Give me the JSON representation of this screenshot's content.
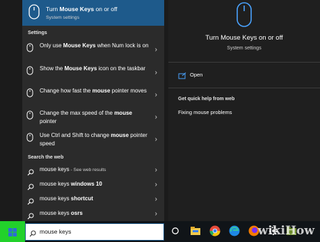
{
  "best_match": {
    "title_prefix": "Turn ",
    "title_bold": "Mouse Keys",
    "title_suffix": " on or off",
    "subtitle": "System settings",
    "icon": "mouse-icon"
  },
  "settings_section": {
    "heading": "Settings",
    "items": [
      {
        "pre": "Only use ",
        "bold": "Mouse Keys",
        "post": " when Num lock is on"
      },
      {
        "pre": "Show the ",
        "bold": "Mouse Keys",
        "post": " icon on the taskbar"
      },
      {
        "pre": "Change how fast the ",
        "bold": "mouse",
        "post": " pointer moves"
      },
      {
        "pre": "Change the max speed of the ",
        "bold": "mouse",
        "post": " pointer"
      },
      {
        "pre": "Use Ctrl and Shift to change ",
        "bold": "mouse",
        "post": " pointer speed"
      }
    ]
  },
  "web_section": {
    "heading": "Search the web",
    "items": [
      {
        "pre": "mouse keys",
        "bold": "",
        "note": " - See web results"
      },
      {
        "pre": "mouse keys ",
        "bold": "windows 10",
        "note": ""
      },
      {
        "pre": "mouse keys ",
        "bold": "shortcut",
        "note": ""
      },
      {
        "pre": "mouse keys ",
        "bold": "osrs",
        "note": ""
      }
    ]
  },
  "preview": {
    "title": "Turn Mouse Keys on or off",
    "subtitle": "System settings",
    "open_label": "Open",
    "help_heading": "Get quick help from web",
    "help_link": "Fixing mouse problems"
  },
  "search": {
    "value": "mouse keys"
  },
  "taskbar": {
    "icons": [
      "task-view-icon",
      "file-explorer-icon",
      "chrome-icon",
      "edge-icon",
      "firefox-icon",
      "settings-icon",
      "folder-icon"
    ]
  },
  "watermark": "wikiHow",
  "colors": {
    "accent": "#1e5a8b",
    "start_highlight": "#22d12b",
    "panel": "#2b2b2b",
    "preview_panel": "#1f1f1f"
  }
}
